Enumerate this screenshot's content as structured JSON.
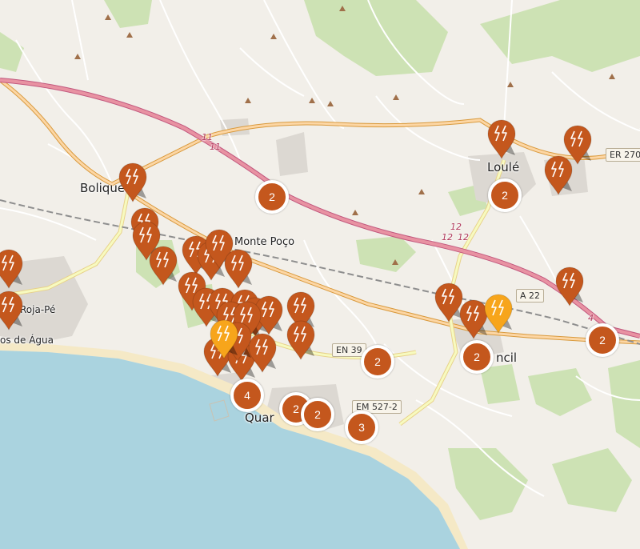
{
  "map": {
    "places": [
      {
        "name": "Boliqueime",
        "text": "Boliquei",
        "size": "big"
      },
      {
        "name": "Loule",
        "text": "Loulé",
        "size": "big"
      },
      {
        "name": "Monte Poco",
        "text": "Monte Poço",
        "size": "mid"
      },
      {
        "name": "Roja-Pe",
        "text": "Roja-Pé",
        "size": "small"
      },
      {
        "name": "Olhos de Agua",
        "text": "os de Água",
        "size": "small"
      },
      {
        "name": "Quarteira",
        "text": "Quar",
        "size": "big"
      },
      {
        "name": "Almancil",
        "text": "ncil",
        "size": "big"
      }
    ],
    "road_shields": [
      "ER 270",
      "A 22",
      "EN 39",
      "EM 527-2"
    ],
    "road_numbers": [
      "11",
      "11",
      "12",
      "12",
      "12",
      "4"
    ],
    "markers": {
      "icon": "charging-station-icon",
      "color": "#c4571d",
      "highlight_color": "#f7a51b",
      "pins": [
        {
          "variant": "normal"
        },
        {
          "variant": "normal"
        },
        {
          "variant": "normal"
        },
        {
          "variant": "normal"
        },
        {
          "variant": "normal"
        },
        {
          "variant": "normal"
        },
        {
          "variant": "normal"
        },
        {
          "variant": "normal"
        },
        {
          "variant": "normal"
        },
        {
          "variant": "normal"
        },
        {
          "variant": "normal"
        },
        {
          "variant": "normal"
        },
        {
          "variant": "normal"
        },
        {
          "variant": "normal"
        },
        {
          "variant": "normal"
        },
        {
          "variant": "normal"
        },
        {
          "variant": "normal"
        },
        {
          "variant": "normal"
        },
        {
          "variant": "normal"
        },
        {
          "variant": "normal"
        },
        {
          "variant": "normal"
        },
        {
          "variant": "normal"
        },
        {
          "variant": "normal"
        },
        {
          "variant": "normal"
        },
        {
          "variant": "normal"
        },
        {
          "variant": "normal"
        },
        {
          "variant": "normal"
        },
        {
          "variant": "normal"
        },
        {
          "variant": "normal"
        },
        {
          "variant": "normal"
        },
        {
          "variant": "highlight"
        },
        {
          "variant": "highlight"
        }
      ],
      "clusters": [
        "2",
        "2",
        "2",
        "2",
        "2",
        "4",
        "2",
        "2",
        "3"
      ]
    }
  }
}
